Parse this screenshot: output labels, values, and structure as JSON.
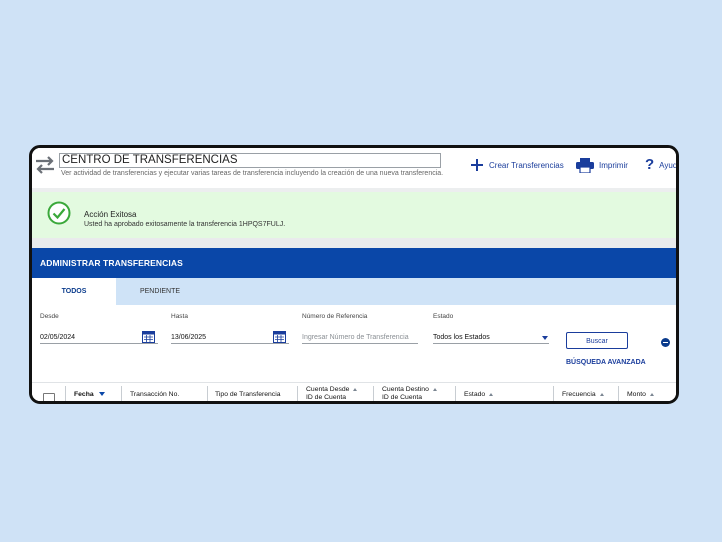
{
  "header": {
    "title": "CENTRO DE TRANSFERENCIAS",
    "subtitle": "Ver actividad de transferencias y ejecutar varias tareas de transferencia incluyendo la creación de una nueva transferencia.",
    "actions": {
      "create": "Crear Transferencias",
      "print": "Imprimir",
      "help": "Ayuda"
    }
  },
  "alert": {
    "title": "Acción Exitosa",
    "message": "Usted ha aprobado exitosamente la transferencia 1HPQS7FULJ."
  },
  "banner": {
    "title": "ADMINISTRAR TRANSFERENCIAS"
  },
  "tabs": [
    {
      "label": "TODOS",
      "active": true
    },
    {
      "label": "PENDIENTE",
      "active": false
    }
  ],
  "filters": {
    "desde": {
      "label": "Desde",
      "value": "02/05/2024"
    },
    "hasta": {
      "label": "Hasta",
      "value": "13/06/2025"
    },
    "referencia": {
      "label": "Número de Referencia",
      "placeholder": "Ingresar Número de Transferencia"
    },
    "estado": {
      "label": "Estado",
      "value": "Todos los Estados"
    },
    "search_button": "Buscar",
    "advanced_link": "BÚSQUEDA AVANZADA"
  },
  "table": {
    "columns": {
      "fecha": "Fecha",
      "transaccion": "Transacción No.",
      "tipo": "Tipo de Transferencia",
      "cuenta_desde_1": "Cuenta Desde",
      "cuenta_desde_2": "ID de Cuenta",
      "cuenta_destino_1": "Cuenta Destino",
      "cuenta_destino_2": "ID de Cuenta",
      "estado": "Estado",
      "frecuencia": "Frecuencia",
      "monto": "Monto"
    }
  },
  "colors": {
    "brand_blue": "#0a47a8",
    "link_blue": "#1a3d9c",
    "success_bg": "#e3fae0",
    "success_green": "#3aa83a"
  }
}
